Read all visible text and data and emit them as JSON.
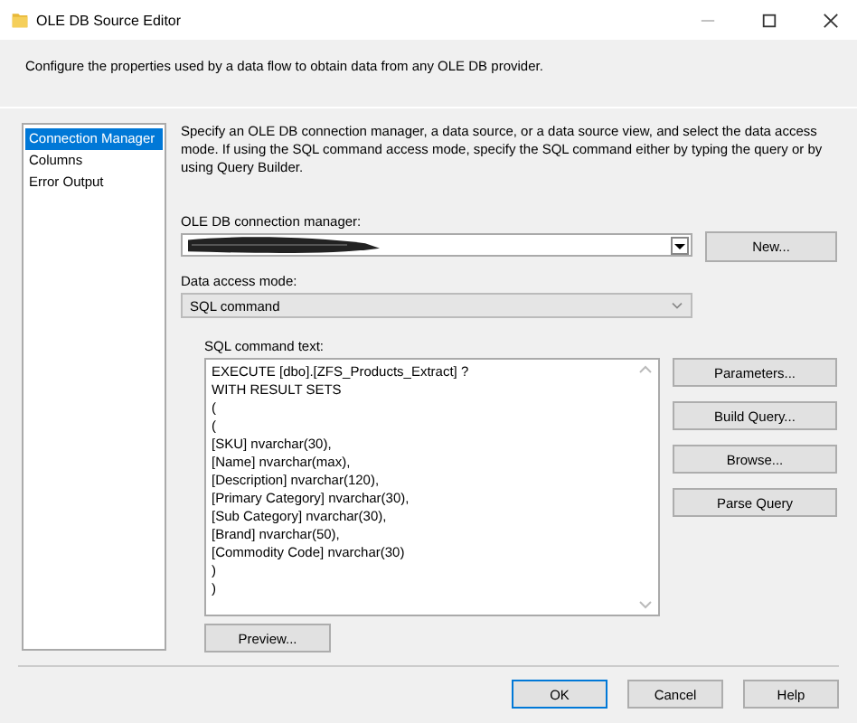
{
  "window": {
    "title": "OLE DB Source Editor"
  },
  "header": {
    "description": "Configure the properties used by a data flow to obtain data from any OLE DB provider."
  },
  "sidebar": {
    "items": [
      {
        "label": "Connection Manager",
        "selected": true
      },
      {
        "label": "Columns",
        "selected": false
      },
      {
        "label": "Error Output",
        "selected": false
      }
    ]
  },
  "instructions": "Specify an OLE DB connection manager, a data source, or a data source view, and select the data access mode. If using the SQL command access mode, specify the SQL command either by typing the query or by using Query Builder.",
  "connection_manager": {
    "label": "OLE DB connection manager:",
    "redacted": true,
    "new_button": "New..."
  },
  "data_access_mode": {
    "label": "Data access mode:",
    "value": "SQL command"
  },
  "sql_command": {
    "label": "SQL command text:",
    "lines": [
      "EXECUTE [dbo].[ZFS_Products_Extract] ?",
      "WITH RESULT SETS",
      "(",
      "(",
      "[SKU] nvarchar(30),",
      "[Name] nvarchar(max),",
      "[Description] nvarchar(120),",
      "[Primary Category] nvarchar(30),",
      "[Sub Category] nvarchar(30),",
      "[Brand] nvarchar(50),",
      "[Commodity Code] nvarchar(30)",
      ")",
      ")"
    ]
  },
  "side_buttons": [
    "Parameters...",
    "Build Query...",
    "Browse...",
    "Parse Query"
  ],
  "preview_button": "Preview...",
  "footer_buttons": [
    {
      "label": "OK",
      "default": true
    },
    {
      "label": "Cancel",
      "default": false
    },
    {
      "label": "Help",
      "default": false
    }
  ]
}
